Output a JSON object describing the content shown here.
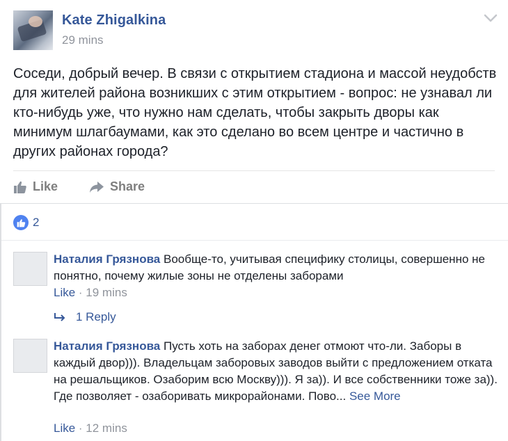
{
  "post": {
    "author": "Kate Zhigalkina",
    "time": "29 mins",
    "text": "Соседи, добрый вечер. В связи с открытием стадиона и массой неудобств для жителей района возникших с этим открытием - вопрос: не узнавал ли кто-нибудь уже, что нужно нам сделать, чтобы закрыть дворы как минимум шлагбаумами, как это сделано во всем центре и частично в других районах города?"
  },
  "actions": {
    "like": "Like",
    "share": "Share"
  },
  "reactions": {
    "count": "2"
  },
  "comments": [
    {
      "author": "Наталия Грязнова",
      "text": "Вообще-то, учитывая специфику столицы, совершенно не понятно, почему жилые зоны не отделены заборами",
      "like": "Like",
      "separator": " · ",
      "time": "19 mins",
      "replies": "1 Reply"
    },
    {
      "author": "Наталия Грязнова",
      "text": "Пусть хоть на заборах денег отмоют что-ли. Заборы в каждый двор))). Владельцам заборовых заводов выйти с предложением отката на решальщиков. Озаборим всю Москву))). Я за)). И все собственники тоже за)). Где позволяет - озаборивать микрорайонами. Пово...",
      "see_more": "See More",
      "like": "Like",
      "separator": " · ",
      "time": "12 mins"
    }
  ],
  "colors": {
    "link": "#365899",
    "muted": "#90949c",
    "text": "#1d2129",
    "like_bubble": "#4f82f0"
  }
}
